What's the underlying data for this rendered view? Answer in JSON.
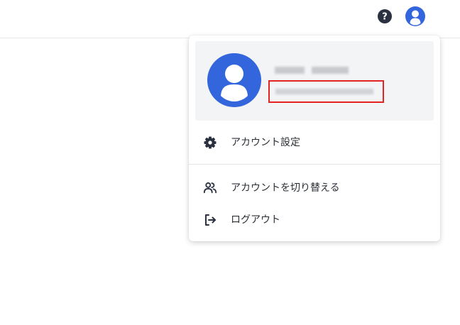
{
  "header": {
    "help_icon": "question-circle-icon",
    "account_icon": "user-circle-icon"
  },
  "colors": {
    "accent": "#3366dd",
    "icon_dark": "#2b3140",
    "highlight_border": "#e32424"
  },
  "profile": {
    "name": "",
    "email": ""
  },
  "menu": {
    "items": [
      {
        "label": "アカウント設定",
        "icon": "gear-icon"
      },
      {
        "label": "アカウントを切り替える",
        "icon": "users-icon"
      },
      {
        "label": "ログアウト",
        "icon": "logout-icon"
      }
    ]
  }
}
